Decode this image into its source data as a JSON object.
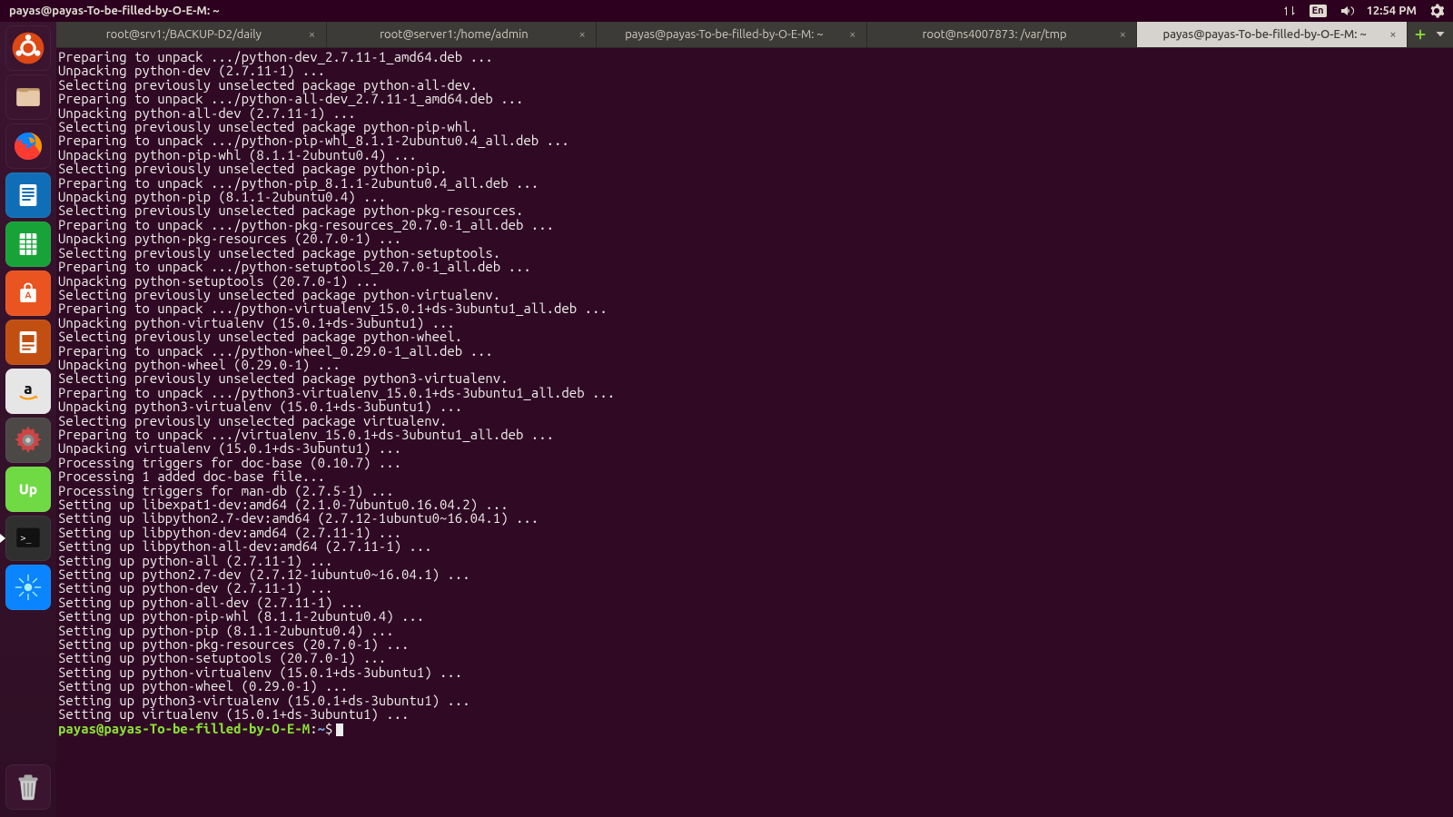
{
  "menubar": {
    "title": "payas@payas-To-be-filled-by-O-E-M: ~",
    "lang_indicator": "En",
    "clock": "12:54 PM"
  },
  "launcher": {
    "items": [
      {
        "name": "dash-icon",
        "bg": "#3b1430",
        "glyph": "ubuntu"
      },
      {
        "name": "files-icon",
        "bg": "#3b1430",
        "glyph": "files"
      },
      {
        "name": "firefox-icon",
        "bg": "#3b1430",
        "glyph": "firefox"
      },
      {
        "name": "writer-icon",
        "bg": "#106eb6",
        "glyph": "doc"
      },
      {
        "name": "calc-icon",
        "bg": "#17a338",
        "glyph": "sheet"
      },
      {
        "name": "software-icon",
        "bg": "#e95420",
        "glyph": "bag"
      },
      {
        "name": "impress-icon",
        "bg": "#c24f12",
        "glyph": "slides"
      },
      {
        "name": "amazon-icon",
        "bg": "#e6e6e6",
        "glyph": "amazon"
      },
      {
        "name": "settings-icon",
        "bg": "#4b4846",
        "glyph": "gear"
      },
      {
        "name": "upwork-icon",
        "bg": "#6fda44",
        "glyph": "up"
      },
      {
        "name": "terminal-icon",
        "bg": "#2f2f2f",
        "glyph": "term",
        "running": true
      },
      {
        "name": "app-blue-icon",
        "bg": "#0a84ff",
        "glyph": "spark"
      }
    ],
    "trash_name": "trash-icon"
  },
  "tabs": [
    {
      "label": "root@srv1:/BACKUP-D2/daily",
      "active": false
    },
    {
      "label": "root@server1:/home/admin",
      "active": false
    },
    {
      "label": "payas@payas-To-be-filled-by-O-E-M: ~",
      "active": false
    },
    {
      "label": "root@ns4007873: /var/tmp",
      "active": false
    },
    {
      "label": "payas@payas-To-be-filled-by-O-E-M: ~",
      "active": true
    }
  ],
  "terminal": {
    "lines": [
      "Preparing to unpack .../python-dev_2.7.11-1_amd64.deb ...",
      "Unpacking python-dev (2.7.11-1) ...",
      "Selecting previously unselected package python-all-dev.",
      "Preparing to unpack .../python-all-dev_2.7.11-1_amd64.deb ...",
      "Unpacking python-all-dev (2.7.11-1) ...",
      "Selecting previously unselected package python-pip-whl.",
      "Preparing to unpack .../python-pip-whl_8.1.1-2ubuntu0.4_all.deb ...",
      "Unpacking python-pip-whl (8.1.1-2ubuntu0.4) ...",
      "Selecting previously unselected package python-pip.",
      "Preparing to unpack .../python-pip_8.1.1-2ubuntu0.4_all.deb ...",
      "Unpacking python-pip (8.1.1-2ubuntu0.4) ...",
      "Selecting previously unselected package python-pkg-resources.",
      "Preparing to unpack .../python-pkg-resources_20.7.0-1_all.deb ...",
      "Unpacking python-pkg-resources (20.7.0-1) ...",
      "Selecting previously unselected package python-setuptools.",
      "Preparing to unpack .../python-setuptools_20.7.0-1_all.deb ...",
      "Unpacking python-setuptools (20.7.0-1) ...",
      "Selecting previously unselected package python-virtualenv.",
      "Preparing to unpack .../python-virtualenv_15.0.1+ds-3ubuntu1_all.deb ...",
      "Unpacking python-virtualenv (15.0.1+ds-3ubuntu1) ...",
      "Selecting previously unselected package python-wheel.",
      "Preparing to unpack .../python-wheel_0.29.0-1_all.deb ...",
      "Unpacking python-wheel (0.29.0-1) ...",
      "Selecting previously unselected package python3-virtualenv.",
      "Preparing to unpack .../python3-virtualenv_15.0.1+ds-3ubuntu1_all.deb ...",
      "Unpacking python3-virtualenv (15.0.1+ds-3ubuntu1) ...",
      "Selecting previously unselected package virtualenv.",
      "Preparing to unpack .../virtualenv_15.0.1+ds-3ubuntu1_all.deb ...",
      "Unpacking virtualenv (15.0.1+ds-3ubuntu1) ...",
      "Processing triggers for doc-base (0.10.7) ...",
      "Processing 1 added doc-base file...",
      "Processing triggers for man-db (2.7.5-1) ...",
      "Setting up libexpat1-dev:amd64 (2.1.0-7ubuntu0.16.04.2) ...",
      "Setting up libpython2.7-dev:amd64 (2.7.12-1ubuntu0~16.04.1) ...",
      "Setting up libpython-dev:amd64 (2.7.11-1) ...",
      "Setting up libpython-all-dev:amd64 (2.7.11-1) ...",
      "Setting up python-all (2.7.11-1) ...",
      "Setting up python2.7-dev (2.7.12-1ubuntu0~16.04.1) ...",
      "Setting up python-dev (2.7.11-1) ...",
      "Setting up python-all-dev (2.7.11-1) ...",
      "Setting up python-pip-whl (8.1.1-2ubuntu0.4) ...",
      "Setting up python-pip (8.1.1-2ubuntu0.4) ...",
      "Setting up python-pkg-resources (20.7.0-1) ...",
      "Setting up python-setuptools (20.7.0-1) ...",
      "Setting up python-virtualenv (15.0.1+ds-3ubuntu1) ...",
      "Setting up python-wheel (0.29.0-1) ...",
      "Setting up python3-virtualenv (15.0.1+ds-3ubuntu1) ...",
      "Setting up virtualenv (15.0.1+ds-3ubuntu1) ..."
    ],
    "prompt_user": "payas@payas-To-be-filled-by-O-E-M",
    "prompt_path": "~",
    "prompt_dollar": "$"
  }
}
